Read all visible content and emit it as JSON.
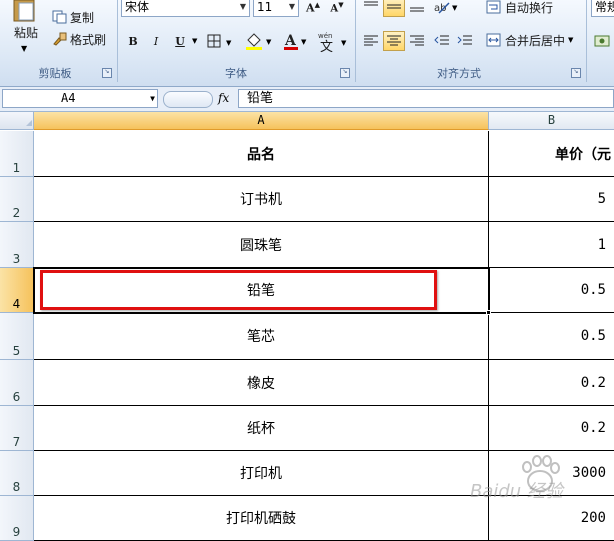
{
  "ribbon": {
    "clipboard": {
      "paste_label": "粘贴",
      "copy_label": "复制",
      "format_painter_label": "格式刷",
      "group_label": "剪贴板"
    },
    "font": {
      "font_name": "宋体",
      "font_size": "11",
      "bold": "B",
      "italic": "I",
      "underline": "U",
      "group_label": "字体",
      "font_color": "#d40000"
    },
    "alignment": {
      "wrap_text_label": "自动换行",
      "merge_center_label": "合并后居中",
      "group_label": "对齐方式"
    },
    "number": {
      "format_label": "常规"
    }
  },
  "formula_bar": {
    "cell_ref": "A4",
    "fx": "fx",
    "content": "铅笔"
  },
  "columns": [
    "A",
    "B"
  ],
  "rows": [
    {
      "num": "1",
      "a": "品名",
      "b": "单价（元"
    },
    {
      "num": "2",
      "a": "订书机",
      "b": "5"
    },
    {
      "num": "3",
      "a": "圆珠笔",
      "b": "1"
    },
    {
      "num": "4",
      "a": "铅笔",
      "b": "0.5"
    },
    {
      "num": "5",
      "a": "笔芯",
      "b": "0.5"
    },
    {
      "num": "6",
      "a": "橡皮",
      "b": "0.2"
    },
    {
      "num": "7",
      "a": "纸杯",
      "b": "0.2"
    },
    {
      "num": "8",
      "a": "打印机",
      "b": "3000"
    },
    {
      "num": "9",
      "a": "打印机硒鼓",
      "b": "200"
    }
  ],
  "watermark": "Baidu 经验"
}
